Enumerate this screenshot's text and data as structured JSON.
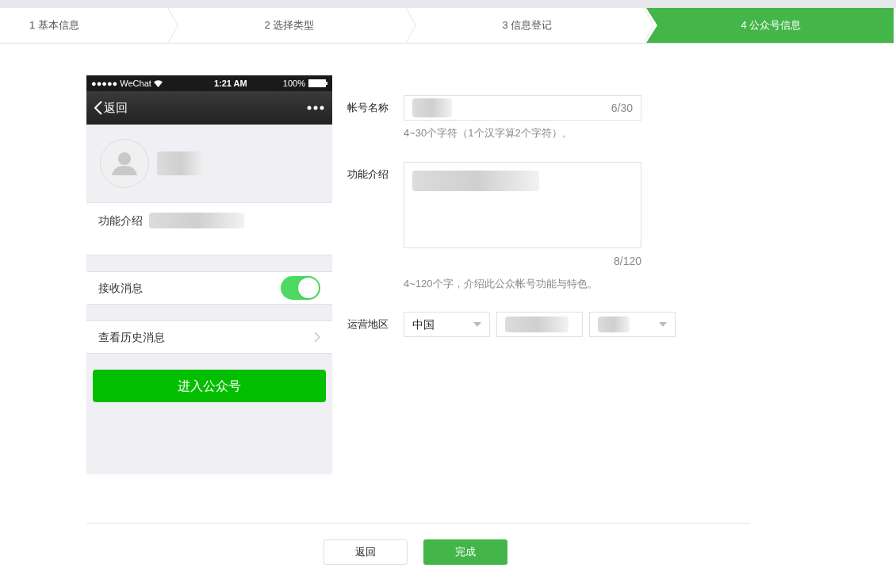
{
  "steps": [
    {
      "label": "1 基本信息",
      "selected": false
    },
    {
      "label": "2 选择类型",
      "selected": false
    },
    {
      "label": "3 信息登记",
      "selected": false
    },
    {
      "label": "4 公众号信息",
      "selected": true
    }
  ],
  "phone": {
    "status": {
      "carrier": "●●●●● WeChat",
      "time": "1:21 AM",
      "battery": "100%"
    },
    "nav": {
      "back": "返回"
    },
    "intro_label": "功能介绍",
    "rows": [
      {
        "kind": "toggle",
        "label": "接收消息",
        "on": true
      },
      {
        "kind": "link",
        "label": "查看历史消息"
      }
    ],
    "enter_button": "进入公众号"
  },
  "form": {
    "name": {
      "label": "帐号名称",
      "counter": "6/30",
      "hint": "4~30个字符（1个汉字算2个字符）。"
    },
    "intro": {
      "label": "功能介绍",
      "counter": "8/120",
      "hint": "4~120个字，介绍此公众帐号功能与特色。"
    },
    "region": {
      "label": "运营地区",
      "country": "中国"
    }
  },
  "buttons": [
    {
      "kind": "secondary",
      "label": "返回"
    },
    {
      "kind": "primary",
      "label": "完成"
    }
  ]
}
